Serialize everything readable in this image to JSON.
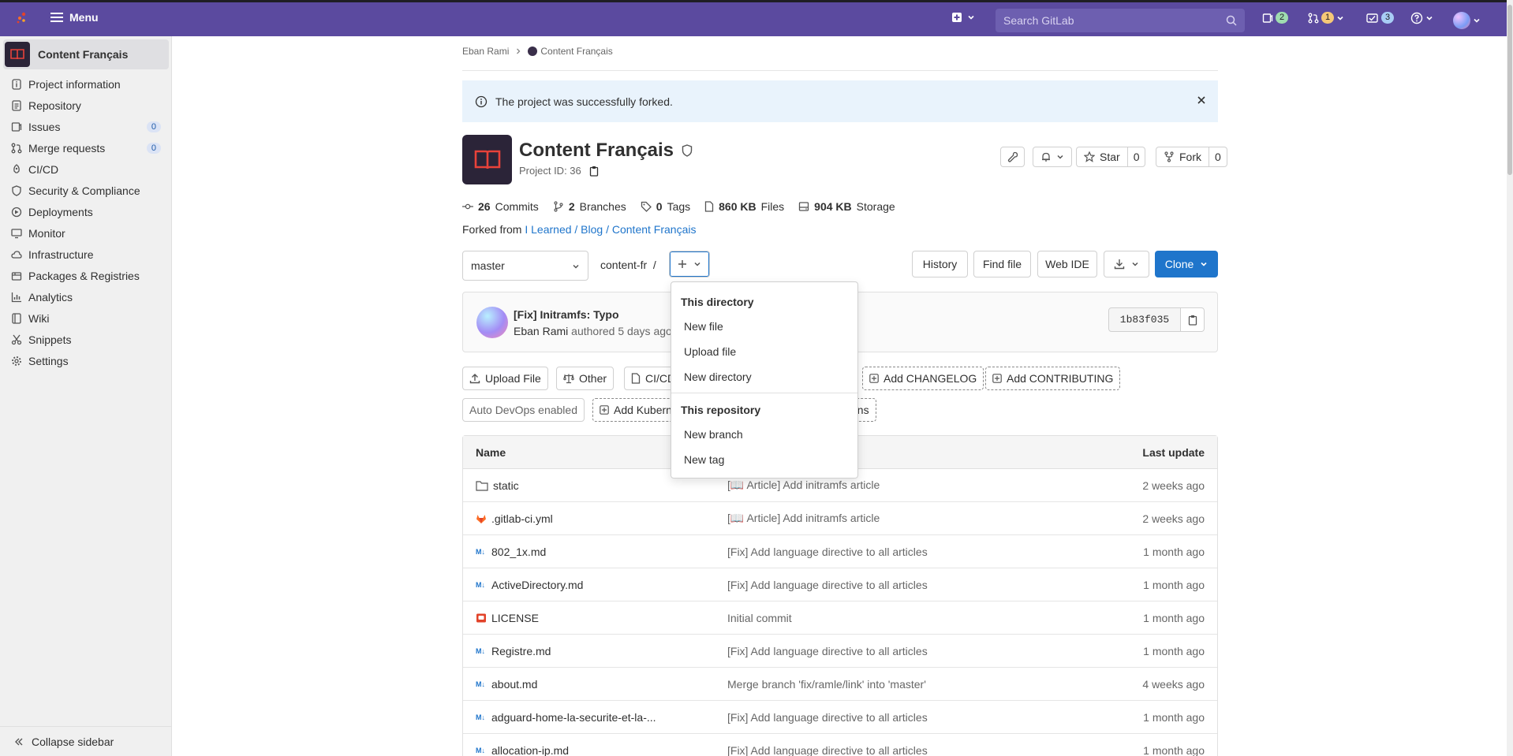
{
  "topbar": {
    "menu_label": "Menu",
    "search_placeholder": "Search GitLab",
    "issues_count": "2",
    "mr_count": "1",
    "todos_count": "3",
    "colors": {
      "bar": "#5b4a9f",
      "issues_pill": "#9fdcb0",
      "mr_pill": "#f5c877",
      "todos_pill": "#a8cdf5"
    }
  },
  "sidebar": {
    "project_name": "Content Français",
    "items": [
      {
        "label": "Project information",
        "icon": "info-doc-icon"
      },
      {
        "label": "Repository",
        "icon": "doc-icon"
      },
      {
        "label": "Issues",
        "icon": "issues-icon",
        "count": "0"
      },
      {
        "label": "Merge requests",
        "icon": "merge-request-icon",
        "count": "0"
      },
      {
        "label": "CI/CD",
        "icon": "rocket-icon"
      },
      {
        "label": "Security & Compliance",
        "icon": "shield-icon"
      },
      {
        "label": "Deployments",
        "icon": "deployments-icon"
      },
      {
        "label": "Monitor",
        "icon": "monitor-icon"
      },
      {
        "label": "Infrastructure",
        "icon": "cloud-icon"
      },
      {
        "label": "Packages & Registries",
        "icon": "package-icon"
      },
      {
        "label": "Analytics",
        "icon": "chart-icon"
      },
      {
        "label": "Wiki",
        "icon": "book-icon"
      },
      {
        "label": "Snippets",
        "icon": "scissors-icon"
      },
      {
        "label": "Settings",
        "icon": "gear-icon"
      }
    ],
    "collapse_label": "Collapse sidebar"
  },
  "breadcrumb": {
    "user": "Eban Rami",
    "project": "Content Français"
  },
  "alert": {
    "text": "The project was successfully forked."
  },
  "project": {
    "title": "Content Français",
    "id_text": "Project ID: 36",
    "star_label": "Star",
    "star_count": "0",
    "fork_label": "Fork",
    "fork_count": "0"
  },
  "stats": {
    "commits_n": "26",
    "commits_label": "Commits",
    "branches_n": "2",
    "branches_label": "Branches",
    "tags_n": "0",
    "tags_label": "Tags",
    "files_n": "860 KB",
    "files_label": "Files",
    "storage_n": "904 KB",
    "storage_label": "Storage"
  },
  "forked": {
    "prefix": "Forked from",
    "link": "I Learned / Blog / Content Français"
  },
  "repo_bar": {
    "branch": "master",
    "path": "content-fr  /",
    "history": "History",
    "find_file": "Find file",
    "web_ide": "Web IDE",
    "clone": "Clone"
  },
  "commit": {
    "title": "[Fix] Initramfs: Typo",
    "author": "Eban Rami",
    "meta": " authored 5 days ago",
    "sha": "1b83f035"
  },
  "quick_actions": {
    "upload_file": "Upload File",
    "other": "Other",
    "cicd": "CI/CD",
    "add_changelog": "Add CHANGELOG",
    "add_contributing": "Add CONTRIBUTING",
    "auto_devops": "Auto DevOps enabled",
    "add_kubernetes": "Add Kubern",
    "integrations_tail": "tions"
  },
  "tree": {
    "col_name": "Name",
    "col_update": "Last update",
    "rows": [
      {
        "name": "static",
        "type": "folder",
        "msg": "[📖 Article] Add initramfs article",
        "when": "2 weeks ago"
      },
      {
        "name": ".gitlab-ci.yml",
        "type": "gitlab",
        "msg": "[📖 Article] Add initramfs article",
        "when": "2 weeks ago"
      },
      {
        "name": "802_1x.md",
        "type": "md",
        "msg": "[Fix] Add language directive to all articles",
        "when": "1 month ago"
      },
      {
        "name": "ActiveDirectory.md",
        "type": "md",
        "msg": "[Fix] Add language directive to all articles",
        "when": "1 month ago"
      },
      {
        "name": "LICENSE",
        "type": "license",
        "msg": "Initial commit",
        "when": "1 month ago"
      },
      {
        "name": "Registre.md",
        "type": "md",
        "msg": "[Fix] Add language directive to all articles",
        "when": "1 month ago"
      },
      {
        "name": "about.md",
        "type": "md",
        "msg": "Merge branch 'fix/ramle/link' into 'master'",
        "when": "4 weeks ago"
      },
      {
        "name": "adguard-home-la-securite-et-la-...",
        "type": "md",
        "msg": "[Fix] Add language directive to all articles",
        "when": "1 month ago"
      },
      {
        "name": "allocation-ip.md",
        "type": "md",
        "msg": "[Fix] Add language directive to all articles",
        "when": "1 month ago"
      }
    ]
  },
  "dropdown": {
    "section1": "This directory",
    "new_file": "New file",
    "upload_file": "Upload file",
    "new_directory": "New directory",
    "section2": "This repository",
    "new_branch": "New branch",
    "new_tag": "New tag"
  }
}
